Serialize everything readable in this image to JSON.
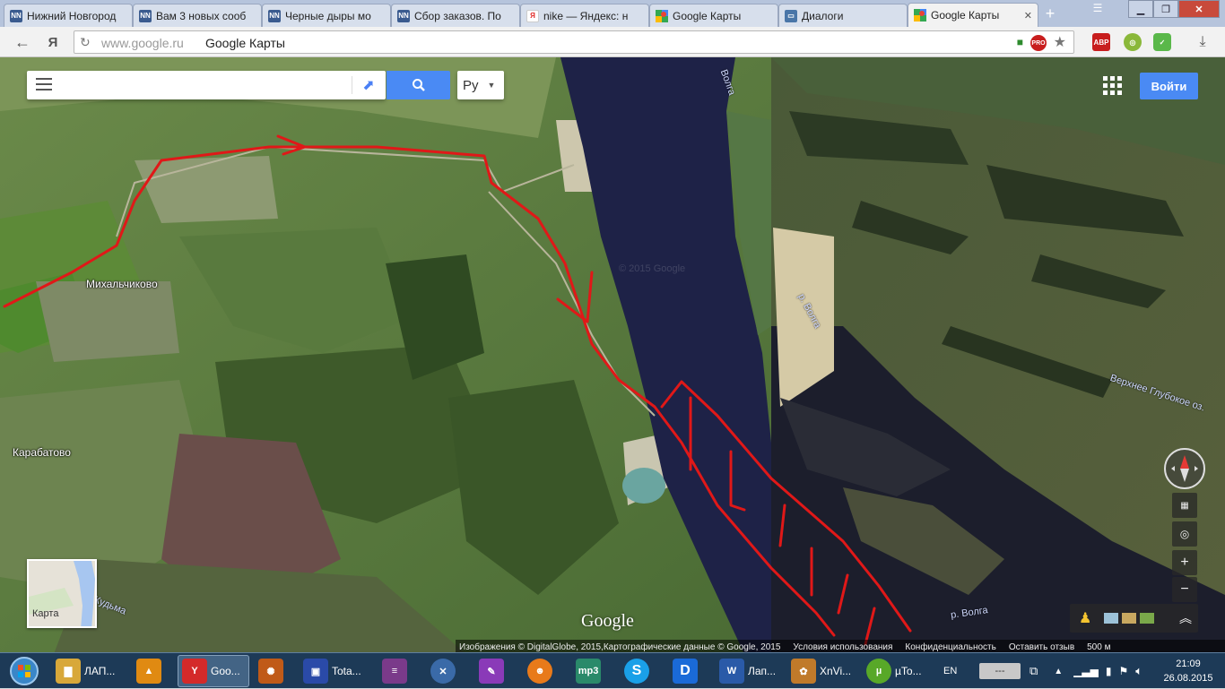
{
  "tabs": [
    {
      "title": "Нижний Новгород",
      "favicon": "NN",
      "color": "#3a5b8f"
    },
    {
      "title": "Вам 3 новых сооб",
      "favicon": "NN",
      "color": "#3a5b8f"
    },
    {
      "title": "Черные дыры мо",
      "favicon": "NN",
      "color": "#3a5b8f"
    },
    {
      "title": "Сбор заказов. По",
      "favicon": "NN",
      "color": "#3a5b8f"
    },
    {
      "title": "nike — Яндекс: н",
      "favicon": "Я",
      "color": "#e12a26"
    },
    {
      "title": "Google Карты",
      "favicon": "maps-icon",
      "color": "#34a853"
    },
    {
      "title": "Диалоги",
      "favicon": "chat-icon",
      "color": "#4a76a8"
    },
    {
      "title": "Google Карты",
      "favicon": "maps-icon",
      "color": "#34a853",
      "active": true
    }
  ],
  "toolbar": {
    "url_host": "www.google.ru",
    "page_title": "Google Карты",
    "ext_pro": "PRO",
    "ext_abp": "ABP"
  },
  "map": {
    "search_placeholder": "",
    "language_button": "Ру",
    "signin_button": "Войти",
    "minimap_label": "Карта",
    "google_logo": "Google",
    "watermark": "© 2015 Google",
    "places": {
      "mikhalchikovo": "Михальчиково",
      "karabatovo": "Карабатово",
      "volga_top": "Волга",
      "volga_mid": "р. Волга",
      "volga_bottom": "р. Волга",
      "lake": "Верхнее Глубокое оз.",
      "kudma": "Кудьма"
    },
    "footer": {
      "imagery": "Изображения © DigitalGlobe, 2015,Картографические данные © Google, 2015",
      "terms": "Условия использования",
      "privacy": "Конфиденциальность",
      "feedback": "Оставить отзыв",
      "scale": "500 м"
    }
  },
  "taskbar": {
    "items": [
      {
        "label": "ЛАП...",
        "icon": "folder-icon",
        "color": "#d8a83a"
      },
      {
        "label": "",
        "icon": "aimp-icon",
        "color": "#e08a12"
      },
      {
        "label": "Goo...",
        "icon": "yandex-browser-icon",
        "color": "#d42a2a"
      },
      {
        "label": "",
        "icon": "game-icon",
        "color": "#c05a18"
      },
      {
        "label": "Tota...",
        "icon": "total-commander-icon",
        "color": "#2a4aa8"
      },
      {
        "label": "",
        "icon": "winrar-icon",
        "color": "#7a3a8a"
      },
      {
        "label": "",
        "icon": "x-icon",
        "color": "#3a6aa8"
      },
      {
        "label": "",
        "icon": "onenote-icon",
        "color": "#8a3ab8"
      },
      {
        "label": "",
        "icon": "avatar-app-icon",
        "color": "#e87a1a"
      },
      {
        "label": "mp3",
        "icon": "mp3-icon",
        "color": "#2a8a6a"
      },
      {
        "label": "S",
        "icon": "skype-icon",
        "color": "#1aa0e8"
      },
      {
        "label": "D",
        "icon": "d-icon",
        "color": "#1a6ad8"
      },
      {
        "label": "Лап...",
        "icon": "word-icon",
        "color": "#2a5aa8"
      },
      {
        "label": "XnVi...",
        "icon": "xnview-icon",
        "color": "#c07a2a"
      },
      {
        "label": "µTo...",
        "icon": "utorrent-icon",
        "color": "#58a828"
      }
    ],
    "lang": "EN",
    "time": "21:09",
    "date": "26.08.2015"
  }
}
